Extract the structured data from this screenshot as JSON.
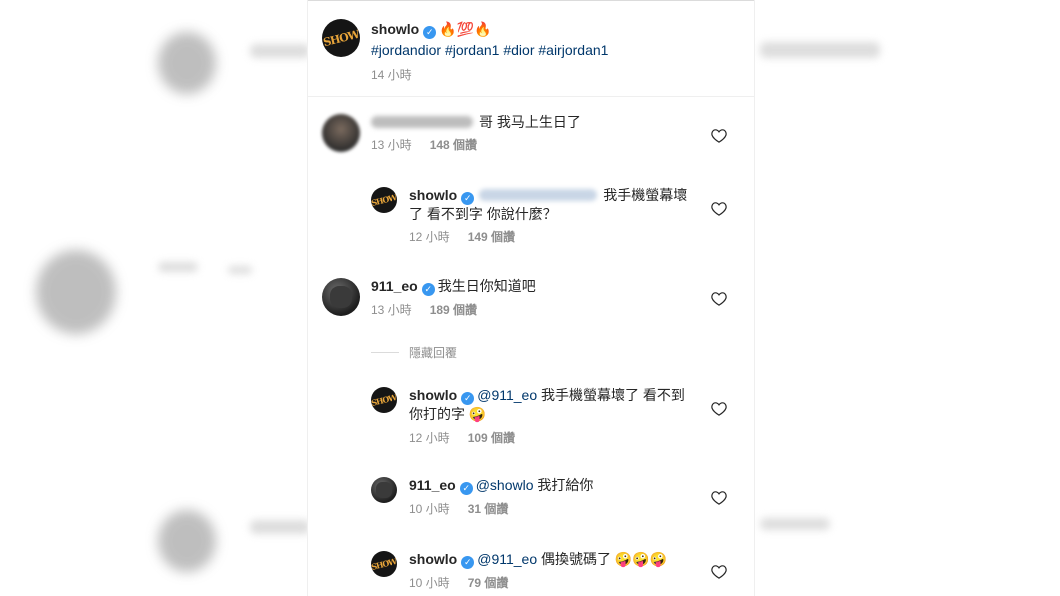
{
  "post": {
    "username": "showlo",
    "avatar_text": "SHOW",
    "caption_emojis": "🔥💯🔥",
    "hashtags": [
      "#jordandior",
      "#jordan1",
      "#dior",
      "#airjordan1"
    ],
    "time": "14 小時"
  },
  "comments": [
    {
      "username_hidden": true,
      "text": "哥 我马上生日了",
      "time": "13 小時",
      "likes": "148 個讚"
    },
    {
      "username": "showlo",
      "avatar_text": "SHOW",
      "mention_hidden": true,
      "text": "我手機螢幕壞了 看不到字 你說什麼？",
      "time": "12 小時",
      "likes": "149 個讚"
    },
    {
      "username": "911_eo",
      "text": "我生日你知道吧",
      "time": "13 小時",
      "likes": "189 個讚"
    },
    {
      "username": "showlo",
      "avatar_text": "SHOW",
      "mention": "@911_eo",
      "text": "我手機螢幕壞了 看不到你打的字",
      "emoji": "🤪",
      "time": "12 小時",
      "likes": "109 個讚"
    },
    {
      "username": "911_eo",
      "mention": "@showlo",
      "text": "我打給你",
      "time": "10 小時",
      "likes": "31 個讚"
    },
    {
      "username": "showlo",
      "avatar_text": "SHOW",
      "mention": "@911_eo",
      "text": "偶換號碼了",
      "emoji": "🤪🤪🤪",
      "time": "10 小時",
      "likes": "79 個讚"
    }
  ],
  "hide_replies": "隱藏回覆",
  "icons": {
    "verified": "verified-badge-icon",
    "heart": "heart-outline-icon"
  },
  "colors": {
    "verified": "#3897f0",
    "hashtag": "#00376b",
    "meta": "#8e8e8e"
  }
}
